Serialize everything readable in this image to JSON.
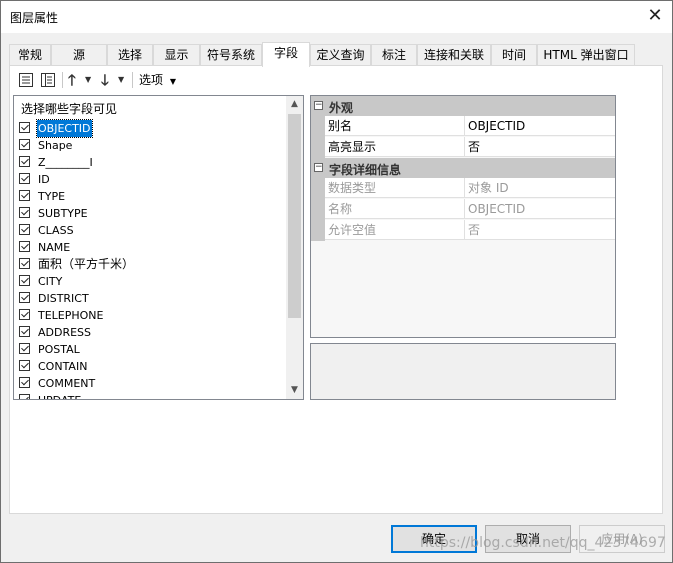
{
  "window": {
    "title": "图层属性"
  },
  "tabs": [
    {
      "label": "常规"
    },
    {
      "label": "源"
    },
    {
      "label": "选择"
    },
    {
      "label": "显示"
    },
    {
      "label": "符号系统"
    },
    {
      "label": "字段",
      "active": true
    },
    {
      "label": "定义查询"
    },
    {
      "label": "标注"
    },
    {
      "label": "连接和关联"
    },
    {
      "label": "时间"
    },
    {
      "label": "HTML 弹出窗口"
    }
  ],
  "toolbar": {
    "options_label": "选项",
    "icons": [
      "table-view-icon",
      "list-view-icon",
      "move-up-icon",
      "move-down-icon"
    ]
  },
  "fields_panel": {
    "heading": "选择哪些字段可见",
    "items": [
      {
        "label": "OBJECTID",
        "checked": true,
        "selected": true
      },
      {
        "label": "Shape",
        "checked": true
      },
      {
        "label": "Z________I",
        "checked": true
      },
      {
        "label": "ID",
        "checked": true
      },
      {
        "label": "TYPE",
        "checked": true
      },
      {
        "label": "SUBTYPE",
        "checked": true
      },
      {
        "label": "CLASS",
        "checked": true
      },
      {
        "label": "NAME",
        "checked": true
      },
      {
        "label": "面积（平方千米）",
        "checked": true
      },
      {
        "label": "CITY",
        "checked": true
      },
      {
        "label": "DISTRICT",
        "checked": true
      },
      {
        "label": "TELEPHONE",
        "checked": true
      },
      {
        "label": "ADDRESS",
        "checked": true
      },
      {
        "label": "POSTAL",
        "checked": true
      },
      {
        "label": "CONTAIN",
        "checked": true
      },
      {
        "label": "COMMENT",
        "checked": true
      },
      {
        "label": "UPDATE",
        "checked": true
      }
    ]
  },
  "properties": {
    "appearance": {
      "label": "外观",
      "rows": [
        {
          "name": "别名",
          "value": "OBJECTID"
        },
        {
          "name": "高亮显示",
          "value": "否"
        }
      ]
    },
    "details": {
      "label": "字段详细信息",
      "rows": [
        {
          "name": "数据类型",
          "value": "对象 ID"
        },
        {
          "name": "名称",
          "value": "OBJECTID"
        },
        {
          "name": "允许空值",
          "value": "否"
        }
      ]
    }
  },
  "buttons": {
    "ok": "确定",
    "cancel": "取消",
    "apply": "应用(A)"
  },
  "watermark": "https://blog.csdn.net/qq_42374697"
}
